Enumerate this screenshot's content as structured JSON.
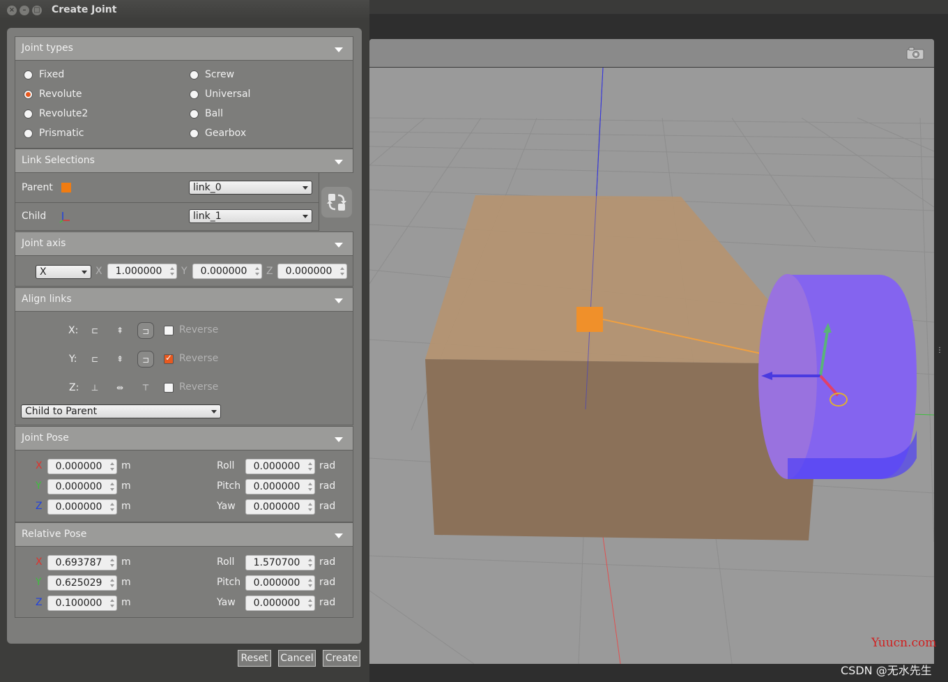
{
  "window": {
    "title": "Create Joint",
    "buttons": [
      "close",
      "minimize",
      "maximize"
    ]
  },
  "joint_types": {
    "header": "Joint types",
    "options": [
      {
        "label": "Fixed",
        "selected": false
      },
      {
        "label": "Revolute",
        "selected": true
      },
      {
        "label": "Revolute2",
        "selected": false
      },
      {
        "label": "Prismatic",
        "selected": false
      },
      {
        "label": "Screw",
        "selected": false
      },
      {
        "label": "Universal",
        "selected": false
      },
      {
        "label": "Ball",
        "selected": false
      },
      {
        "label": "Gearbox",
        "selected": false
      }
    ]
  },
  "link_selections": {
    "header": "Link Selections",
    "parent_label": "Parent",
    "parent_value": "link_0",
    "child_label": "Child",
    "child_value": "link_1"
  },
  "joint_axis": {
    "header": "Joint axis",
    "axis_option": "X",
    "x_label": "X",
    "x_value": "1.000000",
    "y_label": "Y",
    "y_value": "0.000000",
    "z_label": "Z",
    "z_value": "0.000000"
  },
  "align_links": {
    "header": "Align links",
    "rows": [
      {
        "label": "X:",
        "reverse_label": "Reverse",
        "reverse_checked": false
      },
      {
        "label": "Y:",
        "reverse_label": "Reverse",
        "reverse_checked": true
      },
      {
        "label": "Z:",
        "reverse_label": "Reverse",
        "reverse_checked": false
      }
    ],
    "mode": "Child to Parent"
  },
  "joint_pose": {
    "header": "Joint Pose",
    "rows": [
      {
        "axis": "X",
        "value": "0.000000",
        "unit": "m",
        "rot_label": "Roll",
        "rot_value": "0.000000",
        "rot_unit": "rad"
      },
      {
        "axis": "Y",
        "value": "0.000000",
        "unit": "m",
        "rot_label": "Pitch",
        "rot_value": "0.000000",
        "rot_unit": "rad"
      },
      {
        "axis": "Z",
        "value": "0.000000",
        "unit": "m",
        "rot_label": "Yaw",
        "rot_value": "0.000000",
        "rot_unit": "rad"
      }
    ]
  },
  "relative_pose": {
    "header": "Relative Pose",
    "rows": [
      {
        "axis": "X",
        "value": "0.693787",
        "unit": "m",
        "rot_label": "Roll",
        "rot_value": "1.570700",
        "rot_unit": "rad"
      },
      {
        "axis": "Y",
        "value": "0.625029",
        "unit": "m",
        "rot_label": "Pitch",
        "rot_value": "0.000000",
        "rot_unit": "rad"
      },
      {
        "axis": "Z",
        "value": "0.100000",
        "unit": "m",
        "rot_label": "Yaw",
        "rot_value": "0.000000",
        "rot_unit": "rad"
      }
    ]
  },
  "footer": {
    "reset": "Reset",
    "cancel": "Cancel",
    "create": "Create"
  },
  "watermarks": {
    "site": "Yuucn.com",
    "author": "CSDN @无水先生"
  },
  "colors": {
    "accent": "#e8591f",
    "parent_marker": "#f07c12",
    "box": "#b8926e",
    "cylinder": "#8a6cf0"
  }
}
